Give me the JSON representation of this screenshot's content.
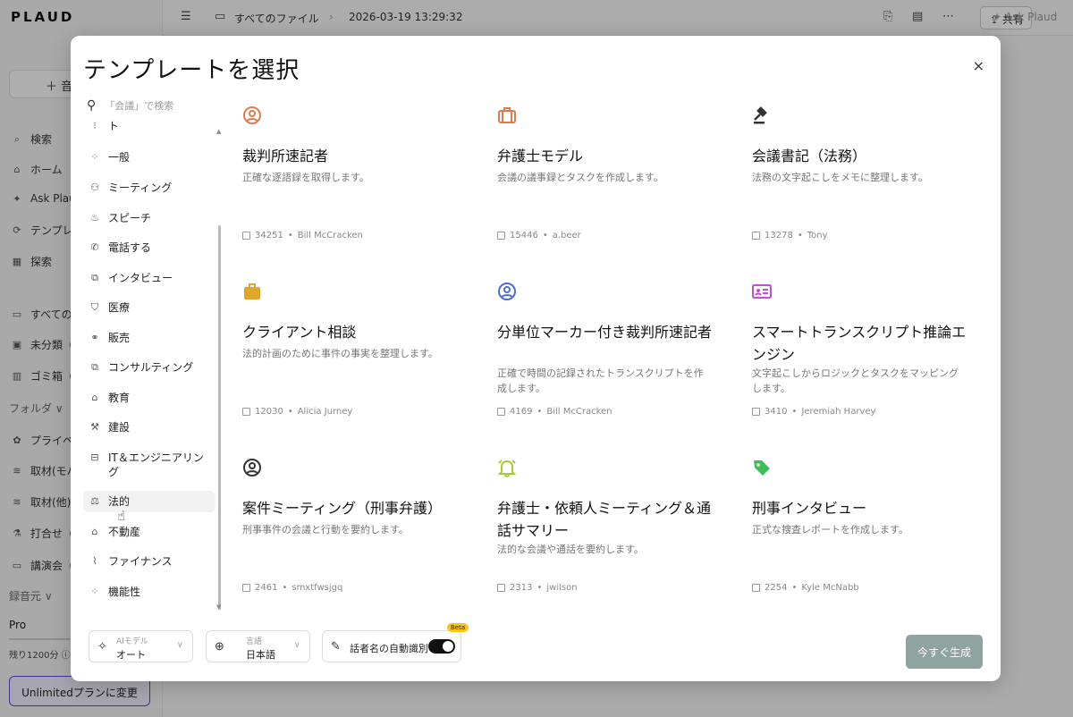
{
  "app": {
    "logo": "PLAUD",
    "new_button": "＋ 音",
    "sidebar_items": [
      {
        "icon": "search-icon",
        "glyph": "⌕",
        "label": "検索"
      },
      {
        "icon": "home-icon",
        "glyph": "⌂",
        "label": "ホーム"
      },
      {
        "icon": "sparkle-icon",
        "glyph": "✦",
        "label": "Ask Plau"
      },
      {
        "icon": "template-icon",
        "glyph": "⟳",
        "label": "テンプレ"
      },
      {
        "icon": "grid-icon",
        "glyph": "▦",
        "label": "探索"
      },
      {
        "icon": "folder-icon",
        "glyph": "▭",
        "label": "すべての"
      },
      {
        "icon": "inbox-icon",
        "glyph": "▣",
        "label": "未分類（"
      },
      {
        "icon": "trash-icon",
        "glyph": "▥",
        "label": "ゴミ箱（"
      }
    ],
    "folders_label": "フォルダ ∨",
    "folder_items": [
      {
        "icon": "folder-private-icon",
        "glyph": "✿",
        "label": "プライベ"
      },
      {
        "icon": "folder-wave-icon",
        "glyph": "≋",
        "label": "取材(モバ"
      },
      {
        "icon": "folder-wave-icon",
        "glyph": "≋",
        "label": "取材(他)"
      },
      {
        "icon": "folder-meeting-icon",
        "glyph": "⚗",
        "label": "打合せ（"
      },
      {
        "icon": "folder-icon",
        "glyph": "▭",
        "label": "講演会（"
      }
    ],
    "source_label": "録音元 ∨",
    "plan": "Pro",
    "remaining": "残り1200分 ⓘ",
    "upgrade_button": "Unlimitedプランに変更",
    "breadcrumb": "すべてのファイル",
    "timestamp": "2026-03-19 13:29:32",
    "share_button": "共有",
    "ask_plaud": "Ask Plaud"
  },
  "modal": {
    "title": "テンプレートを選択",
    "close": "×",
    "search_placeholder": "「会議」で検索",
    "categories": [
      {
        "icon": "category-icon",
        "glyph": "⁝",
        "label": "ト"
      },
      {
        "icon": "general-icon",
        "glyph": "⁘",
        "label": "一般"
      },
      {
        "icon": "meeting-icon",
        "glyph": "⚇",
        "label": "ミーティング"
      },
      {
        "icon": "speech-icon",
        "glyph": "♨",
        "label": "スピーチ"
      },
      {
        "icon": "phone-icon",
        "glyph": "✆",
        "label": "電話する"
      },
      {
        "icon": "interview-icon",
        "glyph": "⧉",
        "label": "インタビュー"
      },
      {
        "icon": "medical-icon",
        "glyph": "⛉",
        "label": "医療"
      },
      {
        "icon": "sales-icon",
        "glyph": "⚭",
        "label": "販売"
      },
      {
        "icon": "consulting-icon",
        "glyph": "⧉",
        "label": "コンサルティング"
      },
      {
        "icon": "education-icon",
        "glyph": "⌂",
        "label": "教育"
      },
      {
        "icon": "construction-icon",
        "glyph": "⚒",
        "label": "建設"
      },
      {
        "icon": "it-icon",
        "glyph": "⊟",
        "label": "IT＆エンジニアリング"
      },
      {
        "icon": "legal-icon",
        "glyph": "⚖",
        "label": "法的"
      },
      {
        "icon": "real-estate-icon",
        "glyph": "⌂",
        "label": "不動産"
      },
      {
        "icon": "finance-icon",
        "glyph": "⌇",
        "label": "ファイナンス"
      },
      {
        "icon": "function-icon",
        "glyph": "⁘",
        "label": "機能性"
      }
    ],
    "templates": [
      {
        "icon": "person-circle-icon",
        "color": "#e07a4f",
        "title": "裁判所速記者",
        "desc": "正確な逐語録を取得します。",
        "count": "34251",
        "author": "Bill McCracken"
      },
      {
        "icon": "briefcase-outline-icon",
        "color": "#e07a4f",
        "title": "弁護士モデル",
        "desc": "会議の議事録とタスクを作成します。",
        "count": "15446",
        "author": "a.beer"
      },
      {
        "icon": "gavel-icon",
        "color": "#333333",
        "title": "会議書記（法務）",
        "desc": "法務の文字起こしをメモに整理します。",
        "count": "13278",
        "author": "Tony"
      },
      {
        "icon": "briefcase-icon",
        "color": "#e0a52b",
        "title": "クライアント相談",
        "desc": "法的計画のために事件の事実を整理します。",
        "count": "12030",
        "author": "Alicia Jurney"
      },
      {
        "icon": "person-circle-icon",
        "color": "#4f6bd6",
        "title": "分単位マーカー付き裁判所速記者",
        "desc": "正確で時間の記録されたトランスクリプトを作成します。",
        "count": "4169",
        "author": "Bill McCracken"
      },
      {
        "icon": "id-card-icon",
        "color": "#c34fd6",
        "title": "スマートトランスクリプト推論エンジン",
        "desc": "文字起こしからロジックとタスクをマッピングします。",
        "count": "3410",
        "author": "Jeremiah Harvey"
      },
      {
        "icon": "person-circle-icon",
        "color": "#333333",
        "title": "案件ミーティング（刑事弁護）",
        "desc": "刑事事件の会議と行動を要約します。",
        "count": "2461",
        "author": "smxtfwsjgq"
      },
      {
        "icon": "bell-icon",
        "color": "#a8c93a",
        "title": "弁護士・依頼人ミーティング＆通話サマリー",
        "desc": "法的な会議や通話を要約します。",
        "count": "2313",
        "author": "jwilson"
      },
      {
        "icon": "tag-icon",
        "color": "#3fbf5a",
        "title": "刑事インタビュー",
        "desc": "正式な捜査レポートを作成します。",
        "count": "2254",
        "author": "Kyle McNabb"
      }
    ],
    "footer": {
      "ai_model_label": "AIモデル",
      "ai_model_value": "オート",
      "language_label": "言語",
      "language_value": "日本語",
      "speaker_label": "話者名の自動識別",
      "speaker_toggle": "on",
      "beta": "Beta",
      "generate_button": "今すぐ生成"
    }
  }
}
